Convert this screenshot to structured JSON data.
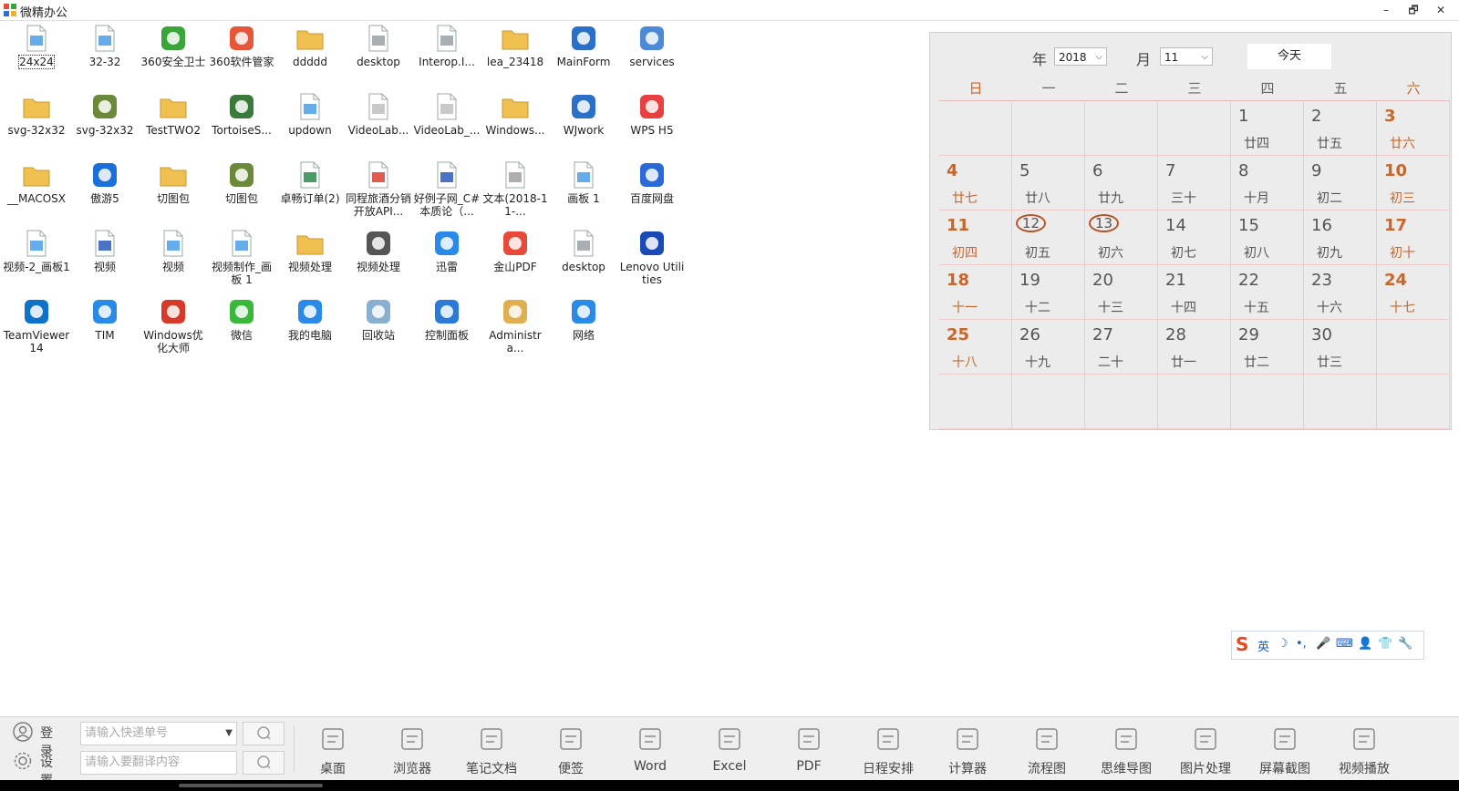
{
  "window": {
    "title": "微精办公",
    "minimize": "–",
    "restore": "🗗",
    "close": "✕"
  },
  "desktop_icons": [
    {
      "label": "24x24",
      "icon": "image-file-icon",
      "color": "#4a9ee8",
      "selected": true
    },
    {
      "label": "32-32",
      "icon": "image-file-icon",
      "color": "#4a9ee8"
    },
    {
      "label": "360安全卫士",
      "icon": "360-security-icon",
      "color": "#3aa63a"
    },
    {
      "label": "360软件管家",
      "icon": "360-software-icon",
      "color": "#e8563a"
    },
    {
      "label": "ddddd",
      "icon": "folder-icon",
      "color": "#f0c050"
    },
    {
      "label": "desktop",
      "icon": "settings-file-icon",
      "color": "#9aa0a8"
    },
    {
      "label": "Interop.I...",
      "icon": "settings-file-icon",
      "color": "#9aa0a8"
    },
    {
      "label": "lea_23418",
      "icon": "folder-icon",
      "color": "#f0c050"
    },
    {
      "label": "MainForm",
      "icon": "window-app-icon",
      "color": "#2a6fc8"
    },
    {
      "label": "services",
      "icon": "gears-icon",
      "color": "#4a8ad8"
    },
    {
      "label": "svg-32x32",
      "icon": "folder-icon",
      "color": "#f0c050"
    },
    {
      "label": "svg-32x32",
      "icon": "archive-icon",
      "color": "#6a8a3a"
    },
    {
      "label": "TestTWO2",
      "icon": "folder-icon",
      "color": "#f0c050"
    },
    {
      "label": "TortoiseS...",
      "icon": "tortoise-icon",
      "color": "#3a7a3a"
    },
    {
      "label": "updown",
      "icon": "image-file-icon",
      "color": "#4a9ee8"
    },
    {
      "label": "VideoLab...",
      "icon": "blank-file-icon",
      "color": "#c0c0c0"
    },
    {
      "label": "VideoLab_...",
      "icon": "blank-file-icon",
      "color": "#c0c0c0"
    },
    {
      "label": "Windows...",
      "icon": "folder-icon",
      "color": "#f0c050"
    },
    {
      "label": "WJwork",
      "icon": "window-app-icon",
      "color": "#2a6fc8"
    },
    {
      "label": "WPS H5",
      "icon": "wps-icon",
      "color": "#e84040"
    },
    {
      "label": "__MACOSX",
      "icon": "folder-icon",
      "color": "#f0c050"
    },
    {
      "label": "傲游5",
      "icon": "maxthon-icon",
      "color": "#1a6fd8"
    },
    {
      "label": "切图包",
      "icon": "folder-icon",
      "color": "#f0c050"
    },
    {
      "label": "切图包",
      "icon": "archive-icon",
      "color": "#6a8a3a"
    },
    {
      "label": "卓畅订单(2)",
      "icon": "excel-file-icon",
      "color": "#2a8a4a"
    },
    {
      "label": "同程旅酒分销开放API...",
      "icon": "pdf-file-icon",
      "color": "#d84030"
    },
    {
      "label": "好例子网_C#本质论（...",
      "icon": "word-file-icon",
      "color": "#2a5ab8"
    },
    {
      "label": "文本(2018-11-...",
      "icon": "text-file-icon",
      "color": "#a0a0a0"
    },
    {
      "label": "画板 1",
      "icon": "image-file-icon",
      "color": "#4a9ee8"
    },
    {
      "label": "百度网盘",
      "icon": "baidu-cloud-icon",
      "color": "#2a6ad8"
    },
    {
      "label": "视频-2_画板1",
      "icon": "image-file-icon",
      "color": "#4a9ee8"
    },
    {
      "label": "视频",
      "icon": "word-file-icon",
      "color": "#2a5ab8"
    },
    {
      "label": "视频",
      "icon": "image-file-icon",
      "color": "#4a9ee8"
    },
    {
      "label": "视频制作_画板 1",
      "icon": "image-file-icon",
      "color": "#4a9ee8"
    },
    {
      "label": "视频处理",
      "icon": "folder-icon",
      "color": "#f0c050"
    },
    {
      "label": "视频处理",
      "icon": "video-app-icon",
      "color": "#555555"
    },
    {
      "label": "迅雷",
      "icon": "thunder-icon",
      "color": "#2a8ae8"
    },
    {
      "label": "金山PDF",
      "icon": "kingsoft-pdf-icon",
      "color": "#e84a3a"
    },
    {
      "label": "desktop",
      "icon": "settings-file-icon",
      "color": "#9aa0a8"
    },
    {
      "label": "Lenovo Utilities",
      "icon": "lenovo-utilities-icon",
      "color": "#1a4ab8"
    },
    {
      "label": "TeamViewer 14",
      "icon": "teamviewer-icon",
      "color": "#0e72c8"
    },
    {
      "label": "TIM",
      "icon": "tim-icon",
      "color": "#2a8ae8"
    },
    {
      "label": "Windows优化大师",
      "icon": "windows-optimizer-icon",
      "color": "#d83a2a"
    },
    {
      "label": "微信",
      "icon": "wechat-icon",
      "color": "#3ab83a"
    },
    {
      "label": "我的电脑",
      "icon": "computer-icon",
      "color": "#2a8ae8"
    },
    {
      "label": "回收站",
      "icon": "recycle-bin-icon",
      "color": "#8ab0d0"
    },
    {
      "label": "控制面板",
      "icon": "control-panel-icon",
      "color": "#2a7ad8"
    },
    {
      "label": "Administra...",
      "icon": "user-folder-icon",
      "color": "#e0b050"
    },
    {
      "label": "网络",
      "icon": "network-icon",
      "color": "#2a8ae8"
    }
  ],
  "calendar": {
    "year_label": "年",
    "year_value": "2018",
    "month_label": "月",
    "month_value": "11",
    "today_button": "今天",
    "weekdays": [
      "日",
      "一",
      "二",
      "三",
      "四",
      "五",
      "六"
    ],
    "first_weekday": 4,
    "days": [
      {
        "day": "1",
        "lunar": "廿四"
      },
      {
        "day": "2",
        "lunar": "廿五"
      },
      {
        "day": "3",
        "lunar": "廿六"
      },
      {
        "day": "4",
        "lunar": "廿七"
      },
      {
        "day": "5",
        "lunar": "廿八"
      },
      {
        "day": "6",
        "lunar": "廿九"
      },
      {
        "day": "7",
        "lunar": "三十"
      },
      {
        "day": "8",
        "lunar": "十月"
      },
      {
        "day": "9",
        "lunar": "初二"
      },
      {
        "day": "10",
        "lunar": "初三"
      },
      {
        "day": "11",
        "lunar": "初四"
      },
      {
        "day": "12",
        "lunar": "初五",
        "highlight": true
      },
      {
        "day": "13",
        "lunar": "初六",
        "highlight": true
      },
      {
        "day": "14",
        "lunar": "初七"
      },
      {
        "day": "15",
        "lunar": "初八"
      },
      {
        "day": "16",
        "lunar": "初九"
      },
      {
        "day": "17",
        "lunar": "初十"
      },
      {
        "day": "18",
        "lunar": "十一"
      },
      {
        "day": "19",
        "lunar": "十二"
      },
      {
        "day": "20",
        "lunar": "十三"
      },
      {
        "day": "21",
        "lunar": "十四"
      },
      {
        "day": "22",
        "lunar": "十五"
      },
      {
        "day": "23",
        "lunar": "十六"
      },
      {
        "day": "24",
        "lunar": "十七"
      },
      {
        "day": "25",
        "lunar": "十八"
      },
      {
        "day": "26",
        "lunar": "十九"
      },
      {
        "day": "27",
        "lunar": "二十"
      },
      {
        "day": "28",
        "lunar": "廿一"
      },
      {
        "day": "29",
        "lunar": "廿二"
      },
      {
        "day": "30",
        "lunar": "廿三"
      }
    ],
    "weekend_color": "#c8662a",
    "highlight_color": "#b5562a"
  },
  "ime_bar": {
    "logo": "S",
    "lang": "英",
    "moon": "☽",
    "punct": "•,",
    "mic": "🎤",
    "keyboard": "⌨",
    "user": "👤",
    "skin": "👕",
    "tools": "🔧"
  },
  "bottom": {
    "login": "登录",
    "settings": "设置",
    "tracking_placeholder": "请输入快递单号",
    "translate_placeholder": "请输入要翻译内容",
    "tools": [
      {
        "label": "桌面",
        "icon": "monitor-icon"
      },
      {
        "label": "浏览器",
        "icon": "compass-icon"
      },
      {
        "label": "笔记文档",
        "icon": "note-edit-icon"
      },
      {
        "label": "便签",
        "icon": "clipboard-icon"
      },
      {
        "label": "Word",
        "icon": "word-doc-icon"
      },
      {
        "label": "Excel",
        "icon": "excel-doc-icon"
      },
      {
        "label": "PDF",
        "icon": "pdf-doc-icon"
      },
      {
        "label": "日程安排",
        "icon": "calendar-grid-icon"
      },
      {
        "label": "计算器",
        "icon": "calculator-icon"
      },
      {
        "label": "流程图",
        "icon": "flowchart-icon"
      },
      {
        "label": "思维导图",
        "icon": "mindmap-icon"
      },
      {
        "label": "图片处理",
        "icon": "picture-icon"
      },
      {
        "label": "屏幕截图",
        "icon": "screenshot-icon"
      },
      {
        "label": "视频播放",
        "icon": "video-play-icon"
      }
    ]
  }
}
